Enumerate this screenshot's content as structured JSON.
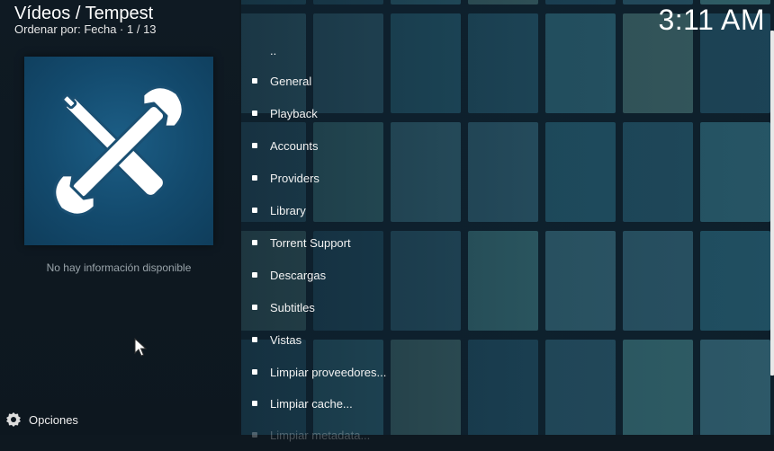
{
  "header": {
    "title": "Vídeos / Tempest",
    "subtitle": "Ordenar por: Fecha  ·  1 / 13",
    "clock": "3:11 AM"
  },
  "info_panel": {
    "poster_icon": "wrench-screwdriver-icon",
    "no_info_text": "No hay información disponible"
  },
  "menu": {
    "parent_label": "..",
    "items": [
      {
        "label": "General"
      },
      {
        "label": "Playback"
      },
      {
        "label": "Accounts"
      },
      {
        "label": "Providers"
      },
      {
        "label": "Library"
      },
      {
        "label": "Torrent Support"
      },
      {
        "label": "Descargas"
      },
      {
        "label": "Subtitles"
      },
      {
        "label": "Vistas"
      },
      {
        "label": "Limpiar proveedores..."
      },
      {
        "label": "Limpiar cache..."
      },
      {
        "label": "Limpiar metadata..."
      }
    ]
  },
  "footer": {
    "options_label": "Opciones",
    "options_icon": "gear-icon"
  },
  "colors": {
    "background": "#0e1820",
    "poster_bg": "#134a6d",
    "text": "#ffffff"
  }
}
